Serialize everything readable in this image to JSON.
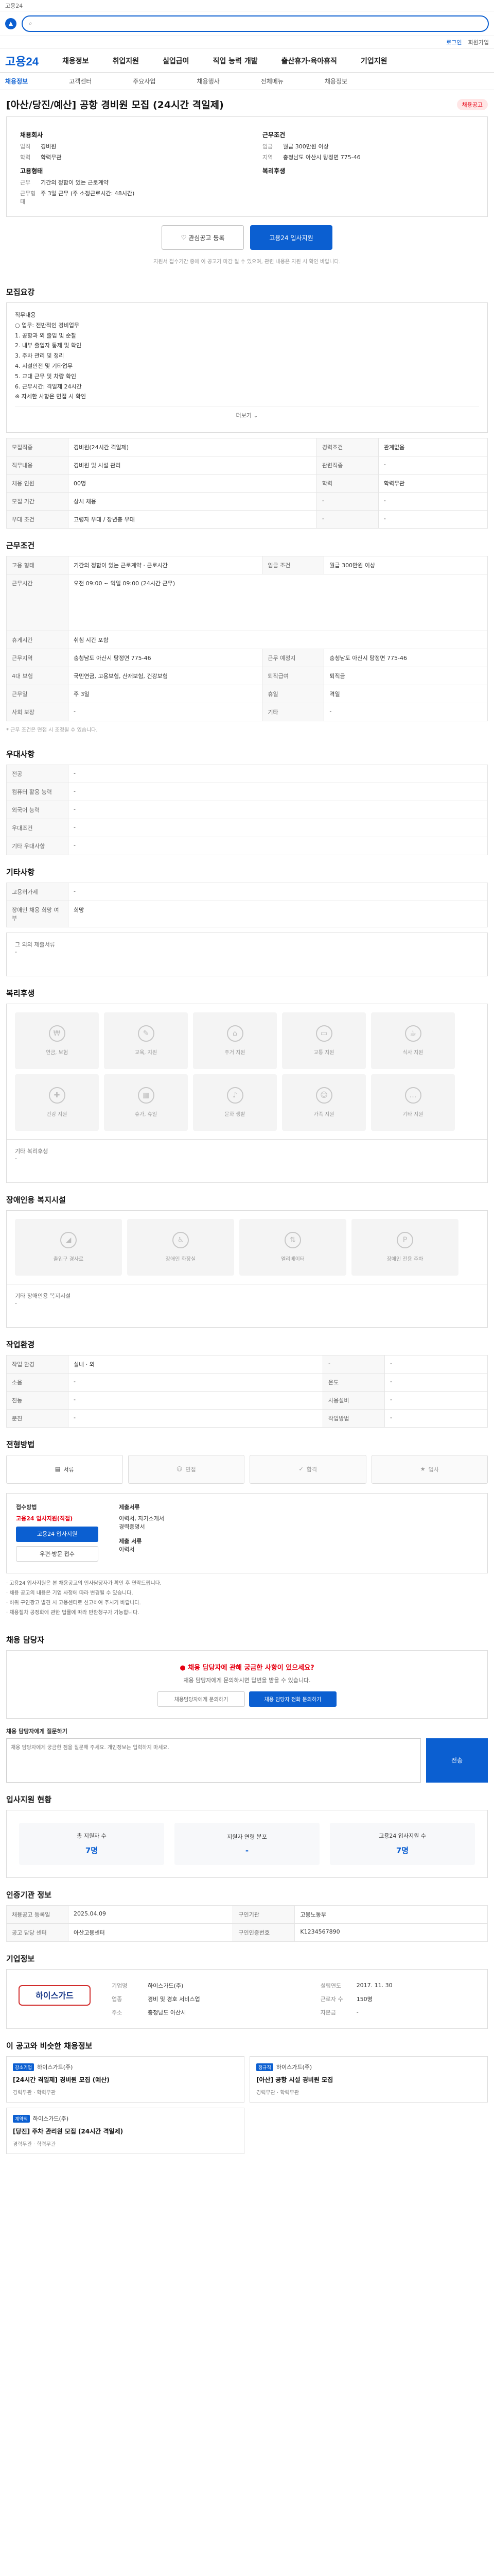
{
  "top": {
    "text": "고용24"
  },
  "util": {
    "login": "로그인",
    "join": "회원가입"
  },
  "gnb": {
    "logo": "고용24",
    "items": [
      "채용정보",
      "취업지원",
      "실업급여",
      "직업 능력 개발",
      "출산휴가·육아휴직",
      "기업지원"
    ]
  },
  "subnav": [
    "채용정보",
    "고객센터",
    "주요사업",
    "채용행사",
    "전체메뉴",
    "채용정보"
  ],
  "job": {
    "title": "[아산/당진/예산] 공항 경비원 모집 (24시간 격일제)",
    "badge": "채용공고",
    "left_title": "채용회사",
    "left": [
      {
        "k": "업직",
        "v": "경비원"
      },
      {
        "k": "학력",
        "v": "학력무관"
      }
    ],
    "left_title2": "고용형태",
    "left2": [
      {
        "k": "근무",
        "v": "기간의 정함이 있는 근로계약"
      },
      {
        "k": "근무형태",
        "v": "주 3일 근무 (주 소정근로시간: 48시간)"
      }
    ],
    "right_title": "근무조건",
    "right": [
      {
        "k": "임금",
        "v": "월급 300만원 이상"
      },
      {
        "k": "지역",
        "v": "충청남도 아산시 탕정면 775-46"
      }
    ],
    "right_title2": "복리후생",
    "save_label": "관심공고 등록",
    "apply_label": "고용24 입사지원",
    "notice": "지원서 접수기간 중에 이 공고가 마감 될 수 있으며, 관련 내용은 지원 시 확인 바랍니다."
  },
  "recruit": {
    "heading": "모집요강",
    "lines": [
      "직무내용",
      "○ 업무: 전반적인 경비업무",
      "1. 공항과 외 출입 및 순찰",
      "2. 내부 출입자 통제 및 확인",
      "3. 주차 관리 및 정리",
      "4. 시설안전 및 기타업무",
      "5. 교대 근무 및 차량 확인",
      "6. 근무시간: 격일제 24시간",
      "※ 자세한 사항은 면접 시 확인"
    ],
    "more": "더보기",
    "table": [
      [
        "모집직종",
        "경비원(24시간 격일제)",
        "경력조건",
        "관계없음"
      ],
      [
        "직무내용",
        "경비원 및 시설 관리",
        "관련직종",
        "-"
      ],
      [
        "채용 인원",
        "00명",
        "학력",
        "학력무관"
      ],
      [
        "모집 기간",
        "상시 채용",
        "-",
        "-"
      ],
      [
        "우대 조건",
        "고령자 우대 / 장년층 우대",
        "-",
        "-"
      ]
    ]
  },
  "conditions": {
    "heading": "근무조건",
    "rows": [
      [
        "고용 형태",
        "기간의 정함이 있는 근로계약 · 근로시간",
        "임금 조건",
        "월급 300만원 이상"
      ],
      [
        "근무시간",
        "오전 09:00 ~ 익일 09:00 (24시간 근무)",
        "-",
        "-"
      ],
      [
        "휴게시간",
        "취침 시간 포함",
        "-",
        "-"
      ],
      [
        "근무지역",
        "충청남도 아산시 탕정면 775-46",
        "근무 예정지",
        "충청남도 아산시 탕정면 775-46"
      ],
      [
        "4대 보험",
        "국민연금, 고용보험, 산재보험, 건강보험",
        "퇴직급여",
        "퇴직금"
      ],
      [
        "근무일",
        "주 3일",
        "휴일",
        "격일"
      ],
      [
        "사회 보장",
        "-",
        "기타",
        "-"
      ]
    ],
    "foot": "* 근무 조건은 면접 시 조정될 수 있습니다."
  },
  "prefer": {
    "heading": "우대사항",
    "rows": [
      [
        "전공",
        "-"
      ],
      [
        "컴퓨터 활용 능력",
        "-"
      ],
      [
        "외국어 능력",
        "-"
      ],
      [
        "우대조건",
        "-"
      ],
      [
        "기타 우대사항",
        "-"
      ]
    ]
  },
  "docs": {
    "heading": "기타사항",
    "rows": [
      [
        "고용허가제",
        "-"
      ],
      [
        "장애인 채용 희망 여부",
        "희망"
      ]
    ],
    "extra_title": "그 외의 제출서류",
    "extra": "-"
  },
  "welfare": {
    "heading": "복리후생",
    "tiles": [
      "연금, 보험",
      "교육, 지원",
      "주거 지원",
      "교통 지원",
      "식사 지원",
      "건강 지원",
      "휴가, 휴일",
      "문화 생활",
      "가족 지원",
      "기타 지원"
    ],
    "other_title": "기타 복리후생",
    "other": "-"
  },
  "disability": {
    "heading": "장애인용 복지시설",
    "tiles": [
      "출입구 경사로",
      "장애인 화장실",
      "엘리베이터",
      "장애인 전용 주차"
    ],
    "other_title": "기타 장애인용 복지시설",
    "other": "-"
  },
  "workplace": {
    "heading": "작업환경",
    "rows": [
      [
        "작업 환경",
        "실내 · 외",
        "-",
        "-"
      ],
      [
        "소음",
        "-",
        "온도",
        "-"
      ],
      [
        "진동",
        "-",
        "사용설비",
        "-"
      ],
      [
        "분진",
        "-",
        "작업방법",
        "-"
      ]
    ]
  },
  "process": {
    "heading": "전형방법",
    "steps": [
      "서류",
      "면접",
      "합격",
      "입사"
    ]
  },
  "applymethod": {
    "left_title": "접수방법",
    "left_red": "고용24 입사지원(직접)",
    "left_btn": "고용24 입사지원",
    "left_btn2": "우편·방문 접수",
    "right_title": "제출서류",
    "right_lines": [
      "이력서, 자기소개서",
      "경력증명서"
    ],
    "right_title2": "제출 서류",
    "right_sub": "이력서"
  },
  "bullets": [
    "· 고용24 입사지원은 본 채용공고의 인사담당자가 확인 후 연락드립니다.",
    "· 채용 공고의 내용은 기업 사정에 따라 변경될 수 있습니다.",
    "· 허위 구인광고 발견 시 고용센터로 신고하여 주시기 바랍니다.",
    "· 채용절차 공정화에 관한 법률에 따라 반환청구가 가능합니다."
  ],
  "inquiry": {
    "heading": "채용 담당자",
    "title": "채용 담당자에 관해 궁금한 사항이 있으세요?",
    "text": "채용 담당자에게 문의하시면 답변을 받을 수 있습니다.",
    "btn1": "채용담당자에게 문의하기",
    "btn2": "채용 담당자 전화 문의하기",
    "qa_title": "채용 담당자에게 질문하기",
    "qa_placeholder": "채용 담당자에게 궁금한 점을 질문해 주세요. 개인정보는 입력하지 마세요.",
    "qa_send": "전송"
  },
  "stats": {
    "heading": "입사지원 현황",
    "items": [
      {
        "label": "총 지원자 수",
        "value": "7명"
      },
      {
        "label": "지원자 연령 분포",
        "value": "-"
      },
      {
        "label": "고용24 입사지원 수",
        "value": "7명"
      }
    ]
  },
  "agency": {
    "heading": "인증기관 정보",
    "rows": [
      [
        "채용공고 등록일",
        "2025.04.09",
        "구인기관",
        "고용노동부"
      ],
      [
        "공고 담당 센터",
        "아산고용센터",
        "구인인증번호",
        "K1234567890"
      ]
    ]
  },
  "company": {
    "heading": "기업정보",
    "logo": "하이스가드",
    "rows": [
      [
        "기업명",
        "하이스가드(주)",
        "설립연도",
        "2017. 11. 30"
      ],
      [
        "업종",
        "경비 및 경호 서비스업",
        "근로자 수",
        "150명"
      ],
      [
        "주소",
        "충청남도 아산시",
        "자본금",
        "-"
      ]
    ]
  },
  "similar": {
    "heading": "이 공고와 비슷한 채용정보",
    "cards": [
      {
        "badge": "강소기업",
        "company": "하이스가드(주)",
        "title": "[24시간 격일제] 경비원 모집 (예산)",
        "meta": "경력무관 · 학력무관"
      },
      {
        "badge": "정규직",
        "company": "하이스가드(주)",
        "title": "[아산] 공항 시설 경비원 모집",
        "meta": "경력무관 · 학력무관"
      },
      {
        "badge": "계약직",
        "company": "하이스가드(주)",
        "title": "[당진] 주차 관리원 모집 (24시간 격일제)",
        "meta": "경력무관 · 학력무관"
      }
    ]
  }
}
